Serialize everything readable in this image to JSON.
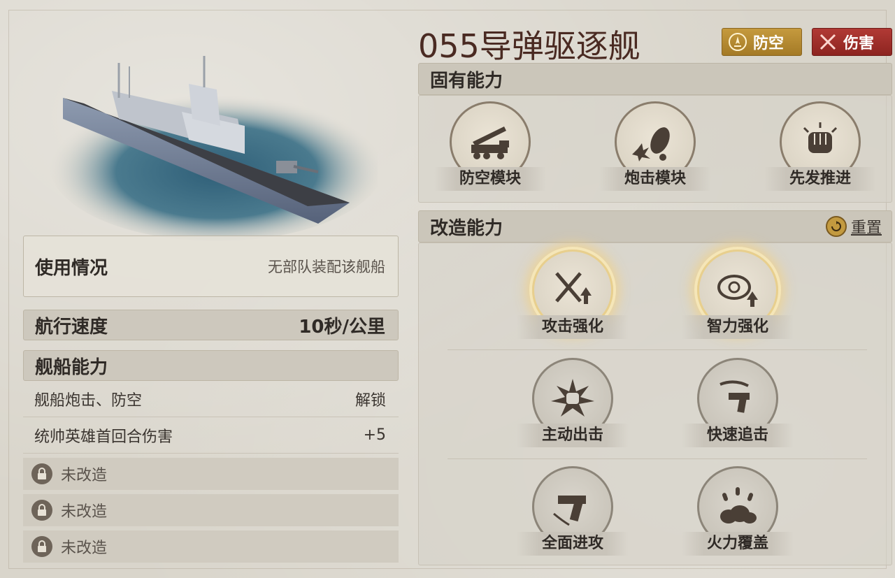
{
  "ship": {
    "name": "055导弹驱逐舰",
    "badges": [
      {
        "label": "防空",
        "color": "#b8903a",
        "icon": "air-defense-icon"
      },
      {
        "label": "伤害",
        "color": "#a52e2a",
        "icon": "crossed-swords-icon"
      }
    ]
  },
  "left": {
    "usage_label": "使用情况",
    "usage_value": "无部队装配该舰船",
    "speed_label": "航行速度",
    "speed_value": "10秒/公里",
    "ability_header": "舰船能力",
    "abilities": [
      {
        "name": "舰船炮击、防空",
        "value": "解锁"
      },
      {
        "name": "统帅英雄首回合伤害",
        "value": "+5"
      }
    ],
    "locked_rows": [
      "未改造",
      "未改造",
      "未改造"
    ]
  },
  "innate": {
    "header": "固有能力",
    "skills": [
      {
        "label": "防空模块",
        "icon": "missile-truck-icon"
      },
      {
        "label": "炮击模块",
        "icon": "shell-explosion-icon"
      },
      {
        "label": "先发推进",
        "icon": "fist-icon"
      }
    ]
  },
  "modify": {
    "header": "改造能力",
    "reset_label": "重置",
    "skills": [
      {
        "label": "攻击强化",
        "icon": "swords-up-icon",
        "active": true
      },
      {
        "label": "智力强化",
        "icon": "brain-up-icon",
        "active": true
      },
      {
        "label": "主动出击",
        "icon": "punch-burst-icon",
        "active": false
      },
      {
        "label": "快速追击",
        "icon": "gun-slash-icon",
        "active": false
      },
      {
        "label": "全面进攻",
        "icon": "pistol-icon",
        "active": false
      },
      {
        "label": "火力覆盖",
        "icon": "bombardment-icon",
        "active": false
      }
    ]
  }
}
